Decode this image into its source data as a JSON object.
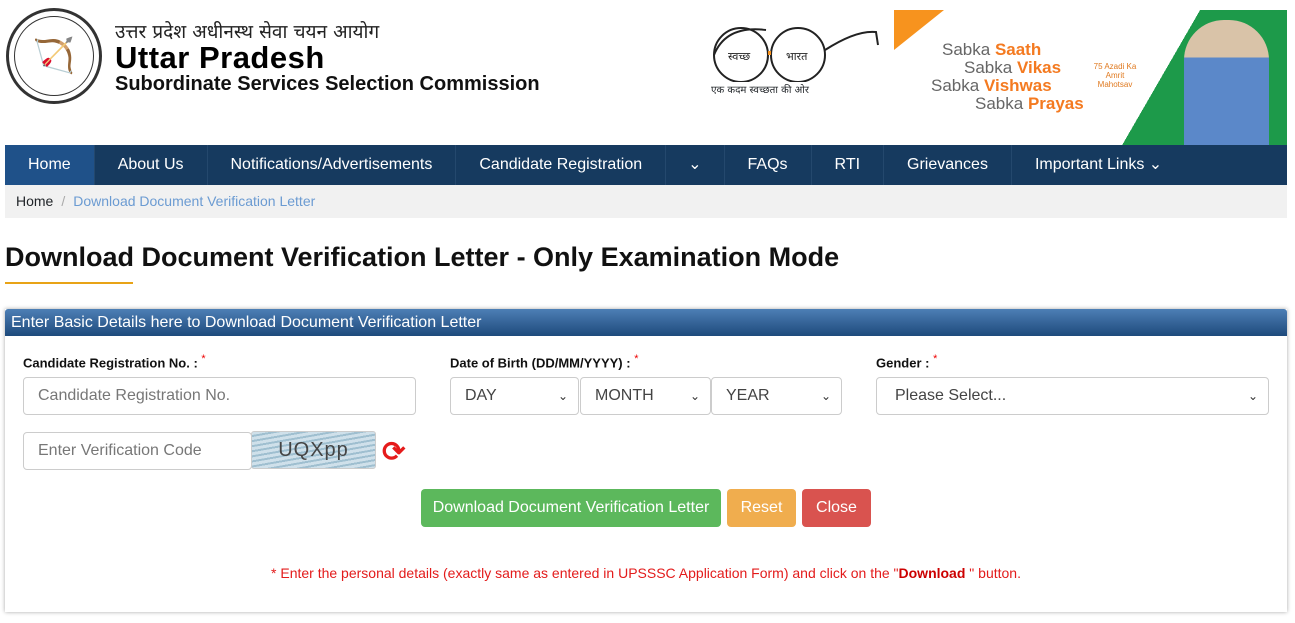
{
  "header": {
    "hindi_title": "उत्तर प्रदेश अधीनस्थ सेवा चयन आयोग",
    "title": "Uttar Pradesh",
    "subtitle": "Subordinate Services Selection Commission",
    "logo_text": "उत्तर प्रदेश सरकार",
    "swachh": {
      "left": "स्वच्छ",
      "right": "भारत",
      "tagline": "एक कदम स्वच्छता की ओर"
    },
    "banner": {
      "lines": [
        {
          "a": "Sabka ",
          "b": "Saath"
        },
        {
          "a": "Sabka ",
          "b": "Vikas"
        },
        {
          "a": "Sabka ",
          "b": "Vishwas"
        },
        {
          "a": "Sabka ",
          "b": "Prayas"
        }
      ],
      "badge": "75 Azadi Ka Amrit Mahotsav"
    }
  },
  "nav": {
    "items": [
      "Home",
      "About Us",
      "Notifications/Advertisements",
      "Candidate Registration",
      "⌄",
      "FAQs",
      "RTI",
      "Grievances",
      "Important Links ⌄"
    ]
  },
  "breadcrumb": {
    "home": "Home",
    "sep": "/",
    "current": "Download Document Verification Letter"
  },
  "page_title": "Download Document Verification Letter - Only Examination Mode",
  "panel": {
    "heading": "Enter Basic Details here to Download Document Verification Letter",
    "reg_label": "Candidate Registration No. :",
    "reg_placeholder": "Candidate Registration No.",
    "dob_label": "Date of Birth (DD/MM/YYYY) :",
    "day": "DAY",
    "month": "MONTH",
    "year": "YEAR",
    "gender_label": "Gender :",
    "gender_value": "Please Select...",
    "required": "*",
    "code_placeholder": "Enter Verification Code",
    "captcha": "UQXpp",
    "download_btn": "Download Document Verification Letter",
    "reset_btn": "Reset",
    "close_btn": "Close",
    "note_pre": "* Enter the personal details (exactly same as entered in UPSSSC Application Form) and click on the \"",
    "note_bold": "Download",
    "note_post": " \" button."
  },
  "colors": {
    "nav": "#163a5f",
    "success": "#5cb85c",
    "warning": "#f0ad4e",
    "danger": "#d9534f",
    "required": "#e31b1b"
  }
}
